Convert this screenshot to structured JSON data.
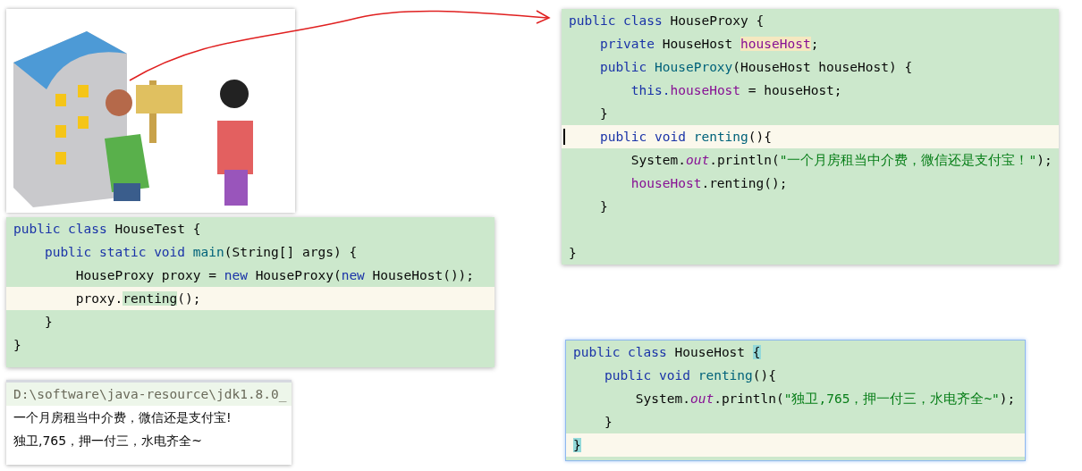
{
  "panels": [
    {
      "kind": "picture"
    },
    {
      "kind": "code",
      "focused": false,
      "lines": [
        {
          "current": false,
          "tokens": [
            {
              "t": "public class ",
              "kind": "kw"
            },
            {
              "t": "HouseTest {",
              "kind": "plain"
            }
          ]
        },
        {
          "current": false,
          "tokens": [
            {
              "t": "    public static void ",
              "kind": "kw"
            },
            {
              "t": "main",
              "kind": "fn"
            },
            {
              "t": "(String[] args) {",
              "kind": "plain"
            }
          ]
        },
        {
          "current": false,
          "tokens": [
            {
              "t": "        HouseProxy proxy = ",
              "kind": "plain"
            },
            {
              "t": "new ",
              "kind": "kw"
            },
            {
              "t": "HouseProxy(",
              "kind": "plain"
            },
            {
              "t": "new ",
              "kind": "kw"
            },
            {
              "t": "HouseHost());",
              "kind": "plain"
            }
          ]
        },
        {
          "current": true,
          "tokens": [
            {
              "t": "        proxy.",
              "kind": "plain"
            },
            {
              "t": "renting",
              "kind": "plain",
              "match_highlighted": true
            },
            {
              "t": "();",
              "kind": "plain"
            }
          ]
        },
        {
          "current": false,
          "tokens": [
            {
              "t": "    }",
              "kind": "plain"
            }
          ]
        },
        {
          "current": false,
          "tokens": [
            {
              "t": "}",
              "kind": "plain"
            }
          ]
        }
      ]
    },
    {
      "kind": "console",
      "lines": [
        {
          "kind": "command",
          "text": "D:\\software\\java-resource\\jdk1.8.0_"
        },
        {
          "kind": "output",
          "text": "一个月房租当中介费，微信还是支付宝!"
        },
        {
          "kind": "output",
          "text": "独卫,765，押一付三，水电齐全~"
        }
      ]
    },
    {
      "kind": "code",
      "focused": false,
      "lines": [
        {
          "current": false,
          "tokens": [
            {
              "t": "public class ",
              "kind": "kw"
            },
            {
              "t": "HouseProxy {",
              "kind": "plain"
            }
          ]
        },
        {
          "current": false,
          "tokens": [
            {
              "t": "    private ",
              "kind": "kw"
            },
            {
              "t": "HouseHost ",
              "kind": "plain"
            },
            {
              "t": "houseHost",
              "kind": "field",
              "usage_highlighted": true
            },
            {
              "t": ";",
              "kind": "plain"
            }
          ]
        },
        {
          "current": false,
          "tokens": [
            {
              "t": "    public ",
              "kind": "kw"
            },
            {
              "t": "HouseProxy",
              "kind": "fn"
            },
            {
              "t": "(HouseHost houseHost) {",
              "kind": "plain"
            }
          ]
        },
        {
          "current": false,
          "tokens": [
            {
              "t": "        this.",
              "kind": "kw"
            },
            {
              "t": "houseHost",
              "kind": "field"
            },
            {
              "t": " = houseHost;",
              "kind": "plain"
            }
          ]
        },
        {
          "current": false,
          "tokens": [
            {
              "t": "    }",
              "kind": "plain"
            }
          ]
        },
        {
          "current": true,
          "caret": true,
          "tokens": [
            {
              "t": "    public void ",
              "kind": "kw"
            },
            {
              "t": "renting",
              "kind": "fn"
            },
            {
              "t": "(){",
              "kind": "plain"
            }
          ]
        },
        {
          "current": false,
          "tokens": [
            {
              "t": "        System.",
              "kind": "plain"
            },
            {
              "t": "out",
              "kind": "static"
            },
            {
              "t": ".println(",
              "kind": "plain"
            },
            {
              "t": "\"一个月房租当中介费，微信还是支付宝！\"",
              "kind": "str"
            },
            {
              "t": ");",
              "kind": "plain"
            }
          ]
        },
        {
          "current": false,
          "tokens": [
            {
              "t": "        houseHost",
              "kind": "field"
            },
            {
              "t": ".renting();",
              "kind": "plain"
            }
          ]
        },
        {
          "current": false,
          "tokens": [
            {
              "t": "    }",
              "kind": "plain"
            }
          ]
        },
        {
          "current": false
        },
        {
          "current": false,
          "tokens": [
            {
              "t": "}",
              "kind": "plain"
            }
          ]
        }
      ]
    },
    {
      "kind": "code",
      "focused": true,
      "lines": [
        {
          "current": false,
          "tokens": [
            {
              "t": "public class ",
              "kind": "kw"
            },
            {
              "t": "HouseHost ",
              "kind": "plain"
            },
            {
              "t": "{",
              "kind": "plain",
              "brace_matched": true
            }
          ]
        },
        {
          "current": false,
          "tokens": [
            {
              "t": "    public void ",
              "kind": "kw"
            },
            {
              "t": "renting",
              "kind": "fn"
            },
            {
              "t": "(){",
              "kind": "plain"
            }
          ]
        },
        {
          "current": false,
          "tokens": [
            {
              "t": "        System.",
              "kind": "plain"
            },
            {
              "t": "out",
              "kind": "static"
            },
            {
              "t": ".println(",
              "kind": "plain"
            },
            {
              "t": "\"独卫,765，押一付三，水电齐全~\"",
              "kind": "str"
            },
            {
              "t": ");",
              "kind": "plain"
            }
          ]
        },
        {
          "current": false,
          "tokens": [
            {
              "t": "    }",
              "kind": "plain"
            }
          ]
        },
        {
          "current": true,
          "tokens": [
            {
              "t": "}",
              "kind": "plain",
              "brace_matched": true
            }
          ]
        }
      ]
    }
  ]
}
